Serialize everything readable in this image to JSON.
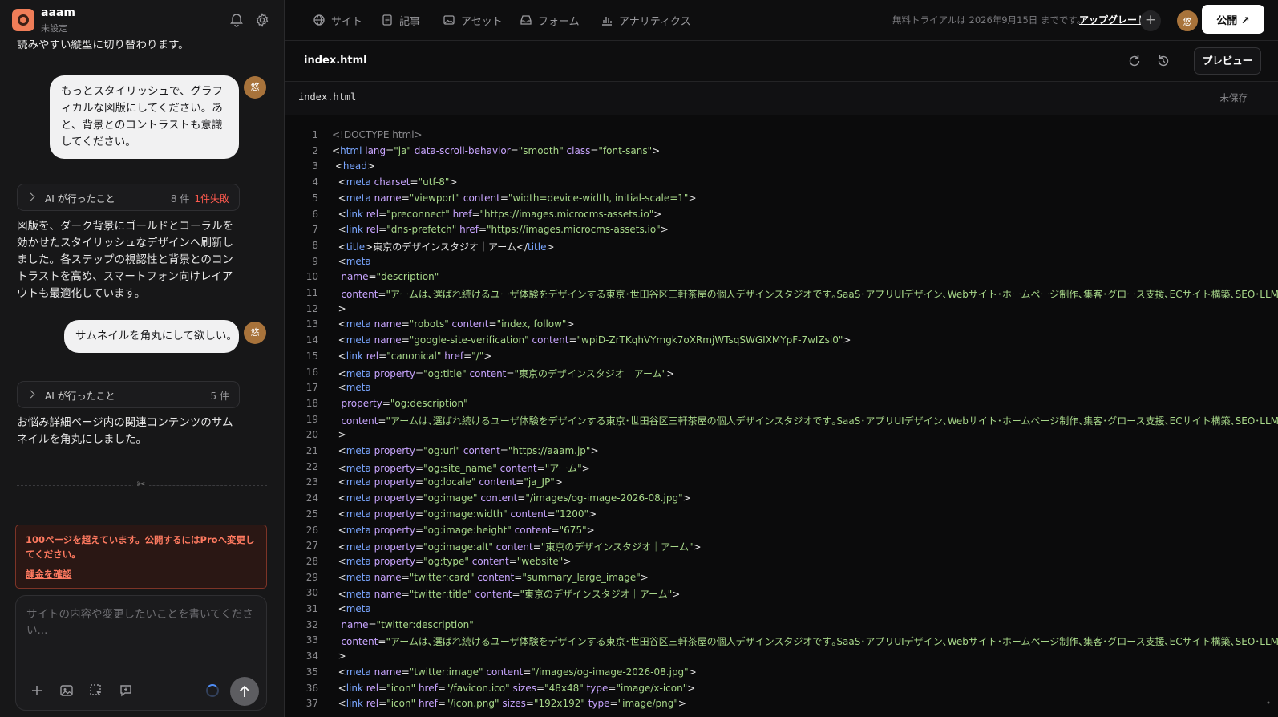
{
  "sidebar": {
    "app_name": "aaam",
    "app_status": "未設定",
    "user_avatar": "悠",
    "messages": [
      {
        "role": "assistant",
        "text": "読みやすい縦型に切り替わります。"
      },
      {
        "role": "user",
        "text": "もっとスタイリッシュで、グラフィカルな図版にしてください。あと、背景とのコントラストも意識してください。"
      },
      {
        "role": "activity",
        "label": "AI が行ったこと",
        "count": "8 件",
        "failed": "1件失敗"
      },
      {
        "role": "assistant",
        "text": "図版を、ダーク背景にゴールドとコーラルを効かせたスタイリッシュなデザインへ刷新しました。各ステップの視認性と背景とのコントラストを高め、スマートフォン向けレイアウトも最適化しています。"
      },
      {
        "role": "user",
        "text": "サムネイルを角丸にして欲しい。"
      },
      {
        "role": "activity",
        "label": "AI が行ったこと",
        "count": "5 件"
      },
      {
        "role": "assistant",
        "text": "お悩み詳細ページ内の関連コンテンツのサムネイルを角丸にしました。"
      }
    ],
    "alert": {
      "text": "100ページを超えています。公開するにはProへ変更してください。",
      "link": "課金を確認"
    },
    "input": {
      "placeholder": "サイトの内容や変更したいことを書いてください..."
    }
  },
  "topbar": {
    "nav": [
      "サイト",
      "記事",
      "アセット",
      "フォーム",
      "アナリティクス"
    ],
    "trial_text": "無料トライアルは 2026年9月15日 までです。",
    "upgrade": "アップグレード",
    "publish": "公開 ↗"
  },
  "editor": {
    "file_title": "index.html",
    "preview": "プレビュー",
    "tab_name": "index.html",
    "status": "未保存",
    "lines": [
      "<!DOCTYPE html>",
      "<html lang=\"ja\" data-scroll-behavior=\"smooth\" class=\"font-sans\">",
      " <head>",
      "  <meta charset=\"utf-8\">",
      "  <meta name=\"viewport\" content=\"width=device-width, initial-scale=1\">",
      "  <link rel=\"preconnect\" href=\"https://images.microcms-assets.io\">",
      "  <link rel=\"dns-prefetch\" href=\"https://images.microcms-assets.io\">",
      "  <title>東京のデザインスタジオ｜アーム</title>",
      "  <meta",
      "   name=\"description\"",
      "   content=\"アームは､選ばれ続けるユーザ体験をデザインする東京･世田谷区三軒茶屋の個人デザインスタジオです｡SaaS･アプリUIデザイン､Webサイト･ホームページ制作､集客･グロース支援､ECサイト構築､SEO･LLMO対",
      "  >",
      "  <meta name=\"robots\" content=\"index, follow\">",
      "  <meta name=\"google-site-verification\" content=\"wpiD-ZrTKqhVYmgk7oXRmjWTsqSWGIXMYpF-7wIZsi0\">",
      "  <link rel=\"canonical\" href=\"/\">",
      "  <meta property=\"og:title\" content=\"東京のデザインスタジオ｜アーム\">",
      "  <meta",
      "   property=\"og:description\"",
      "   content=\"アームは､選ばれ続けるユーザ体験をデザインする東京･世田谷区三軒茶屋の個人デザインスタジオです｡SaaS･アプリUIデザイン､Webサイト･ホームページ制作､集客･グロース支援､ECサイト構築､SEO･LLMO対",
      "  >",
      "  <meta property=\"og:url\" content=\"https://aaam.jp\">",
      "  <meta property=\"og:site_name\" content=\"アーム\">",
      "  <meta property=\"og:locale\" content=\"ja_JP\">",
      "  <meta property=\"og:image\" content=\"/images/og-image-2026-08.jpg\">",
      "  <meta property=\"og:image:width\" content=\"1200\">",
      "  <meta property=\"og:image:height\" content=\"675\">",
      "  <meta property=\"og:image:alt\" content=\"東京のデザインスタジオ｜アーム\">",
      "  <meta property=\"og:type\" content=\"website\">",
      "  <meta name=\"twitter:card\" content=\"summary_large_image\">",
      "  <meta name=\"twitter:title\" content=\"東京のデザインスタジオ｜アーム\">",
      "  <meta",
      "   name=\"twitter:description\"",
      "   content=\"アームは､選ばれ続けるユーザ体験をデザインする東京･世田谷区三軒茶屋の個人デザインスタジオです｡SaaS･アプリUIデザイン､Webサイト･ホームページ制作､集客･グロース支援､ECサイト構築､SEO･LLMO対",
      "  >",
      "  <meta name=\"twitter:image\" content=\"/images/og-image-2026-08.jpg\">",
      "  <link rel=\"icon\" href=\"/favicon.ico\" sizes=\"48x48\" type=\"image/x-icon\">",
      "  <link rel=\"icon\" href=\"/icon.png\" sizes=\"192x192\" type=\"image/png\">"
    ]
  }
}
